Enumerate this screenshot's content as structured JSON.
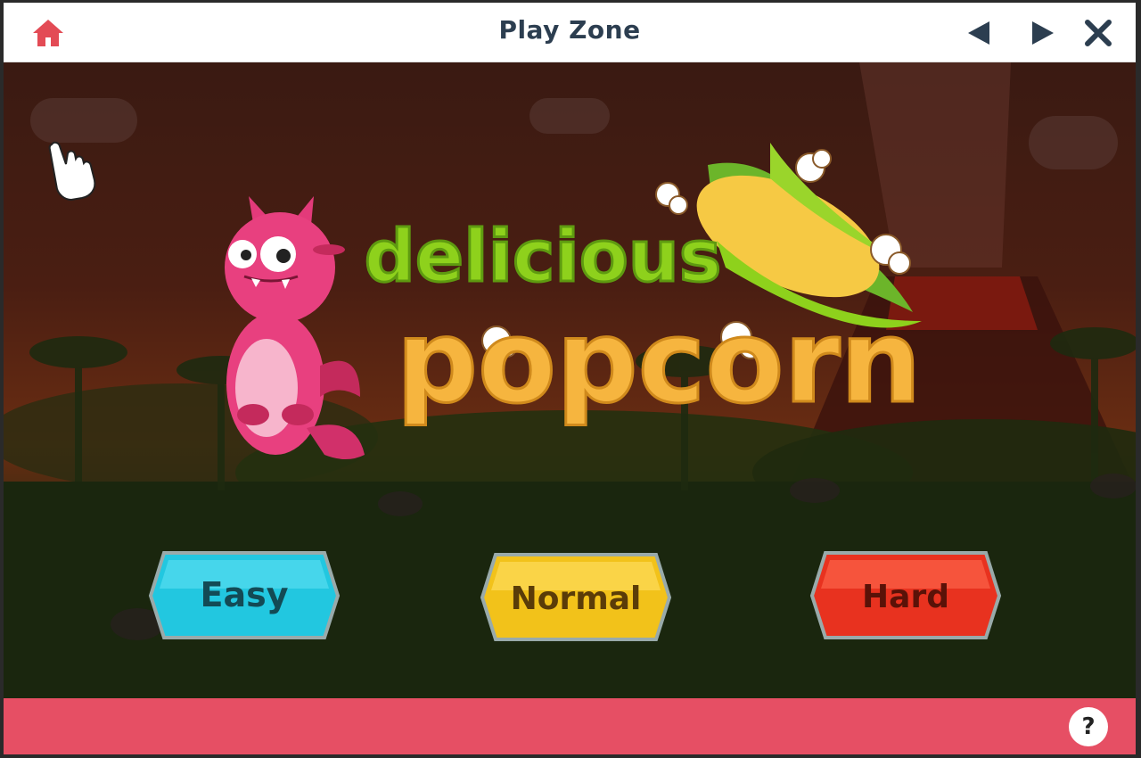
{
  "window": {
    "title": "Play Zone"
  },
  "game": {
    "title_line1": "delicious",
    "title_line2": "popcorn",
    "modes": [
      "Easy",
      "Normal",
      "Hard"
    ]
  },
  "footer": {
    "help_label": "?"
  },
  "colors": {
    "home_icon": "#e34b55",
    "footer": "#e64f64",
    "easy": "#22c7e0",
    "normal": "#f2c21a",
    "hard": "#e8321f",
    "title_green": "#8ed11c",
    "title_orange": "#f6b53f"
  }
}
